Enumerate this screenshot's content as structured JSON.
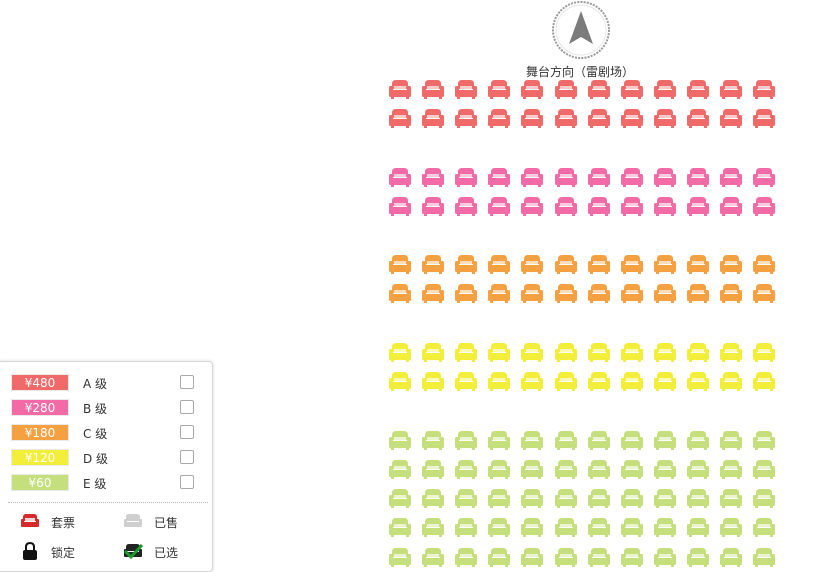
{
  "stage": {
    "label": "舞台方向（雷剧场）"
  },
  "seating": {
    "columns": 12,
    "sections": [
      {
        "level": "A",
        "color": "#f06a6a",
        "rows": 2
      },
      {
        "level": "B",
        "color": "#f26ba6",
        "rows": 2
      },
      {
        "level": "C",
        "color": "#f5a142",
        "rows": 2
      },
      {
        "level": "D",
        "color": "#f2ee39",
        "rows": 2
      },
      {
        "level": "E",
        "color": "#c4df7c",
        "rows": 5
      }
    ]
  },
  "legend": {
    "prices": [
      {
        "price": "¥480",
        "label": "A 级",
        "color": "#f06a6a"
      },
      {
        "price": "¥280",
        "label": "B 级",
        "color": "#f26ba6"
      },
      {
        "price": "¥180",
        "label": "C 级",
        "color": "#f5a142"
      },
      {
        "price": "¥120",
        "label": "D 级",
        "color": "#f2ee39"
      },
      {
        "price": "¥60",
        "label": "E 级",
        "color": "#c4df7c"
      }
    ],
    "statuses": {
      "package": {
        "label": "套票",
        "icon": "package-seat-icon",
        "color": "#d42a2a"
      },
      "sold": {
        "label": "已售",
        "icon": "sold-seat-icon",
        "color": "#cfcfcf"
      },
      "locked": {
        "label": "锁定",
        "icon": "lock-icon",
        "color": "#111111"
      },
      "selected": {
        "label": "已选",
        "icon": "selected-seat-icon",
        "color": "#1a9a2a"
      }
    }
  }
}
